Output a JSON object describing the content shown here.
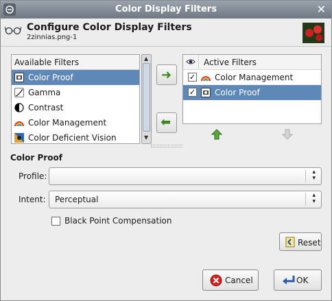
{
  "window": {
    "title": "Color Display Filters"
  },
  "header": {
    "title": "Configure Color Display Filters",
    "subtitle": "2zinnias.png-1"
  },
  "available": {
    "heading": "Available Filters",
    "items": [
      {
        "label": "Color Proof",
        "icon": "color-proof-icon",
        "selected": true
      },
      {
        "label": "Gamma",
        "icon": "gamma-icon",
        "selected": false
      },
      {
        "label": "Contrast",
        "icon": "contrast-icon",
        "selected": false
      },
      {
        "label": "Color Management",
        "icon": "color-management-icon",
        "selected": false
      },
      {
        "label": "Color Deficient Vision",
        "icon": "color-deficient-vision-icon",
        "selected": false
      }
    ]
  },
  "active": {
    "heading": "Active Filters",
    "items": [
      {
        "label": "Color Management",
        "checked": true,
        "selected": false
      },
      {
        "label": "Color Proof",
        "checked": true,
        "selected": true
      }
    ]
  },
  "section": {
    "title": "Color Proof"
  },
  "profile": {
    "label": "Profile:",
    "value": ""
  },
  "intent": {
    "label": "Intent:",
    "value": "Perceptual"
  },
  "black_point": {
    "label": "Black Point Compensation",
    "checked": false
  },
  "buttons": {
    "reset": "Reset",
    "cancel": "Cancel",
    "ok": "OK"
  },
  "colors": {
    "selection": "#5e88b8",
    "arrow_green": "#3a8a1a",
    "titlebar": "#7d8690"
  }
}
